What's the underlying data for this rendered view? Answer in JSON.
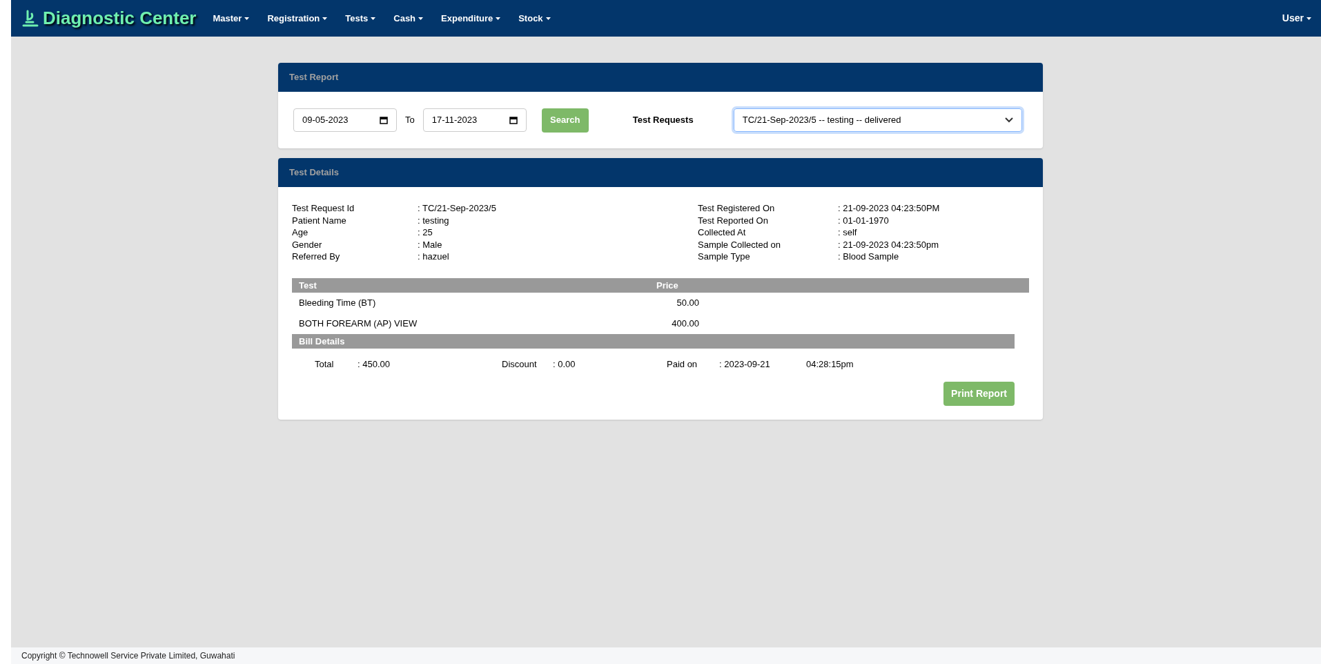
{
  "navbar": {
    "brand": "Diagnostic Center",
    "menus": [
      {
        "label": "Master"
      },
      {
        "label": "Registration"
      },
      {
        "label": "Tests"
      },
      {
        "label": "Cash"
      },
      {
        "label": "Expenditure"
      },
      {
        "label": "Stock"
      }
    ],
    "user_menu": "User"
  },
  "test_report": {
    "title": "Test Report",
    "from_date": "09-05-2023",
    "to_label": "To",
    "to_date": "17-11-2023",
    "search_button": "Search",
    "requests_label": "Test Requests",
    "requests_value": "TC/21-Sep-2023/5 -- testing -- delivered"
  },
  "test_details": {
    "title": "Test Details",
    "left_fields": [
      {
        "label": "Test Request Id",
        "value": ": TC/21-Sep-2023/5"
      },
      {
        "label": "Patient Name",
        "value": ": testing"
      },
      {
        "label": "Age",
        "value": ": 25"
      },
      {
        "label": "Gender",
        "value": ": Male"
      },
      {
        "label": "Referred By",
        "value": ": hazuel"
      }
    ],
    "right_fields": [
      {
        "label": "Test Registered On",
        "value": ": 21-09-2023 04:23:50PM"
      },
      {
        "label": "Test Reported On",
        "value": ": 01-01-1970"
      },
      {
        "label": "Collected At",
        "value": ": self"
      },
      {
        "label": "Sample Collected on",
        "value": ": 21-09-2023 04:23:50pm"
      },
      {
        "label": "Sample Type",
        "value": ": Blood Sample"
      }
    ],
    "table": {
      "columns": [
        "Test",
        "Price"
      ],
      "rows": [
        [
          "Bleeding Time (BT)",
          "50.00"
        ],
        [
          "BOTH FOREARM (AP) VIEW",
          "400.00"
        ]
      ]
    },
    "bill": {
      "title": "Bill Details",
      "total_label": "Total",
      "total": ": 450.00",
      "discount_label": "Discount",
      "discount": ": 0.00",
      "paid_label": "Paid on",
      "paid_date": ": 2023-09-21",
      "paid_time": "04:28:15pm"
    },
    "print_button": "Print Report"
  },
  "footer": "Copyright © Technowell Service Private Limited, Guwahati"
}
